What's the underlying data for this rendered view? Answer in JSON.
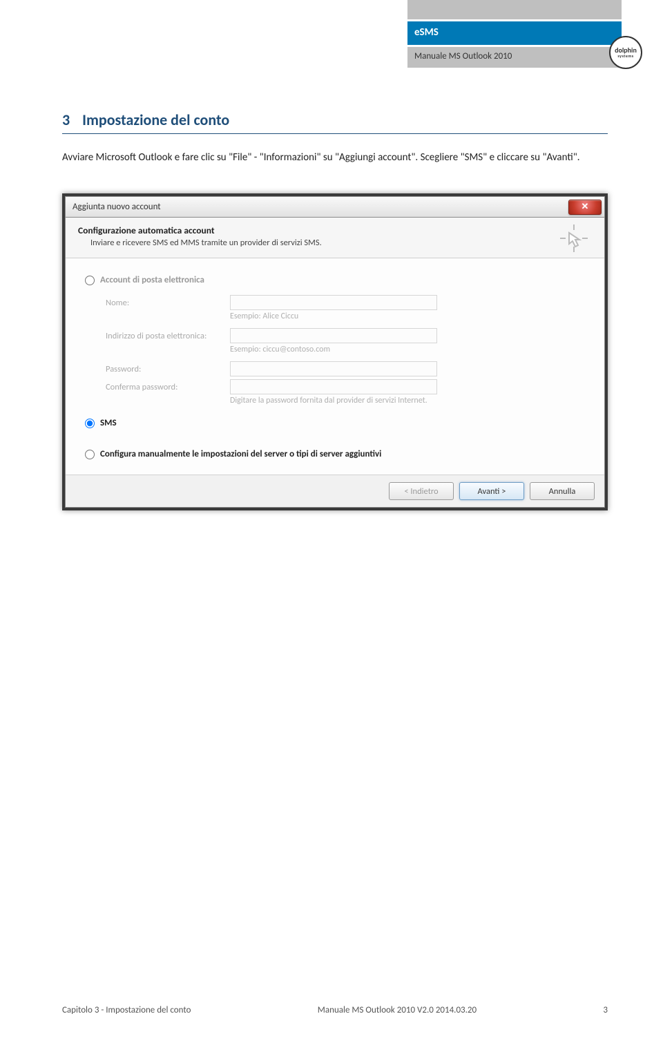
{
  "header": {
    "product": "eSMS",
    "subtitle": "Manuale MS Outlook 2010",
    "logo_line1": "dolphin",
    "logo_line2": "systems"
  },
  "section": {
    "number": "3",
    "title": "Impostazione del conto"
  },
  "body_text": "Avviare Microsoft Outlook e fare clic su \"File\" - \"Informazioni\" su \"Aggiungi account\". Scegliere \"SMS\" e cliccare su \"Avanti\".",
  "dialog": {
    "window_title": "Aggiunta nuovo account",
    "header_title": "Configurazione automatica account",
    "header_sub": "Inviare e ricevere SMS ed MMS tramite un provider di servizi SMS.",
    "options": {
      "email": "Account di posta elettronica",
      "sms": "SMS",
      "manual": "Configura manualmente le impostazioni del server o tipi di server aggiuntivi"
    },
    "fields": {
      "name_label": "Nome:",
      "name_hint": "Esempio: Alice Ciccu",
      "email_label": "Indirizzo di posta elettronica:",
      "email_hint": "Esempio: ciccu@contoso.com",
      "password_label": "Password:",
      "confirm_label": "Conferma password:",
      "password_hint": "Digitare la password fornita dal provider di servizi Internet."
    },
    "buttons": {
      "back": "< Indietro",
      "next": "Avanti >",
      "cancel": "Annulla"
    }
  },
  "footer": {
    "left": "Capitolo 3 - Impostazione del conto",
    "center": "Manuale MS Outlook 2010 V2.0 2014.03.20",
    "right": "3"
  }
}
